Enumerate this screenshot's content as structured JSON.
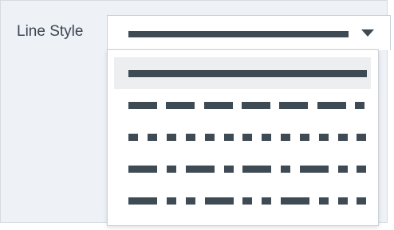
{
  "field": {
    "label": "Line Style",
    "selected_value": "solid"
  },
  "dropdown": {
    "open": true,
    "chevron_icon": "chevron-down-icon",
    "options": [
      {
        "name": "solid",
        "selected": true
      },
      {
        "name": "dash",
        "selected": false
      },
      {
        "name": "dot",
        "selected": false
      },
      {
        "name": "dash-dot",
        "selected": false
      },
      {
        "name": "dash-dot-dot",
        "selected": false
      }
    ]
  },
  "colors": {
    "line": "#3e4a54",
    "panel_background": "#eef1f5",
    "selected_background": "#eceef0"
  }
}
